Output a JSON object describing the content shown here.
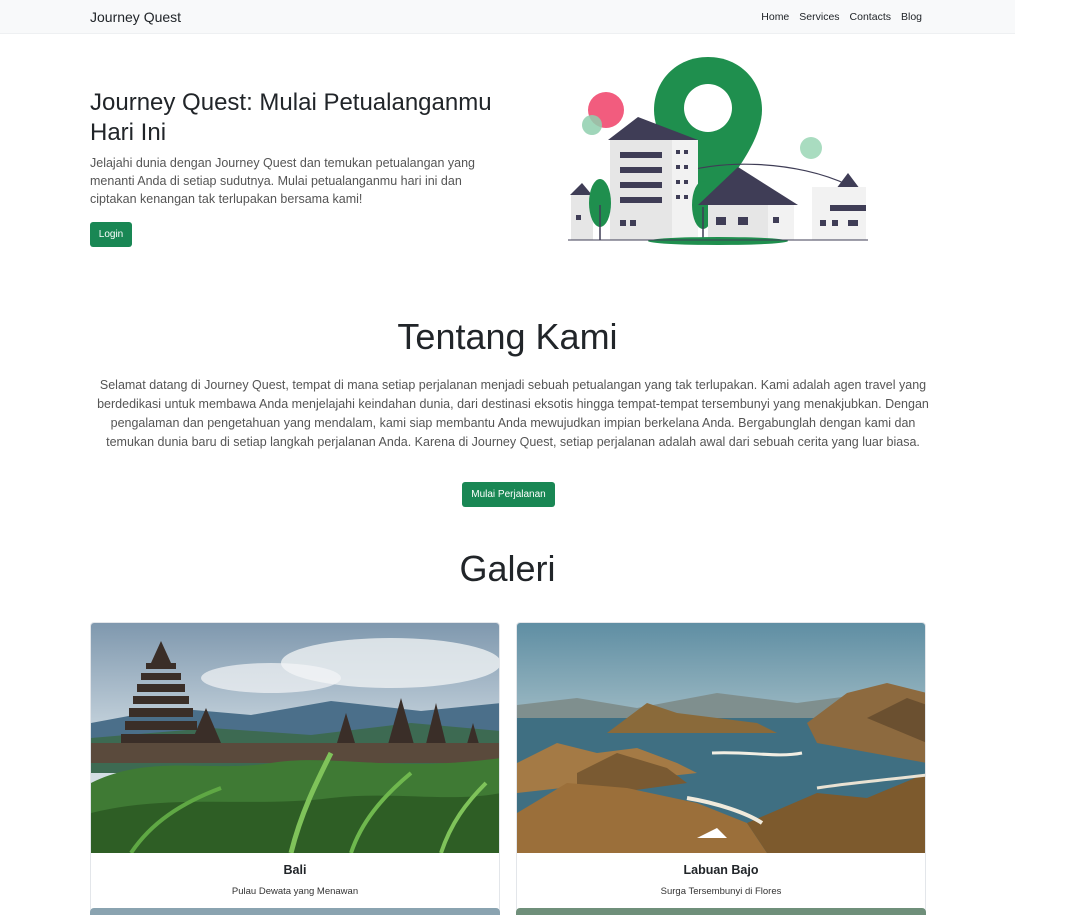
{
  "navbar": {
    "brand": "Journey Quest",
    "links": [
      "Home",
      "Services",
      "Contacts",
      "Blog"
    ]
  },
  "hero": {
    "title": "Journey Quest: Mulai Petualanganmu Hari Ini",
    "text": "Jelajahi dunia dengan Journey Quest dan temukan petualangan yang menanti Anda di setiap sudutnya. Mulai petualanganmu hari ini dan ciptakan kenangan tak terlupakan bersama kami!",
    "login_label": "Login"
  },
  "about": {
    "title": "Tentang Kami",
    "text": "Selamat datang di Journey Quest, tempat di mana setiap perjalanan menjadi sebuah petualangan yang tak terlupakan. Kami adalah agen travel yang berdedikasi untuk membawa Anda menjelajahi keindahan dunia, dari destinasi eksotis hingga tempat-tempat tersembunyi yang menakjubkan. Dengan pengalaman dan pengetahuan yang mendalam, kami siap membantu Anda mewujudkan impian berkelana Anda. Bergabunglah dengan kami dan temukan dunia baru di setiap langkah perjalanan Anda. Karena di Journey Quest, setiap perjalanan adalah awal dari sebuah cerita yang luar biasa.",
    "button_label": "Mulai Perjalanan"
  },
  "gallery": {
    "title": "Galeri",
    "cards": [
      {
        "title": "Bali",
        "text": "Pulau Dewata yang Menawan",
        "image": "bali-temple-photo"
      },
      {
        "title": "Labuan Bajo",
        "text": "Surga Tersembunyi di Flores",
        "image": "labuan-bajo-hills-photo"
      }
    ]
  },
  "colors": {
    "accent": "#198754",
    "navbar_bg": "#f8f9fa",
    "pin_green": "#1f8f4e",
    "building_dark": "#3f3d56",
    "pink": "#f25c7e"
  }
}
